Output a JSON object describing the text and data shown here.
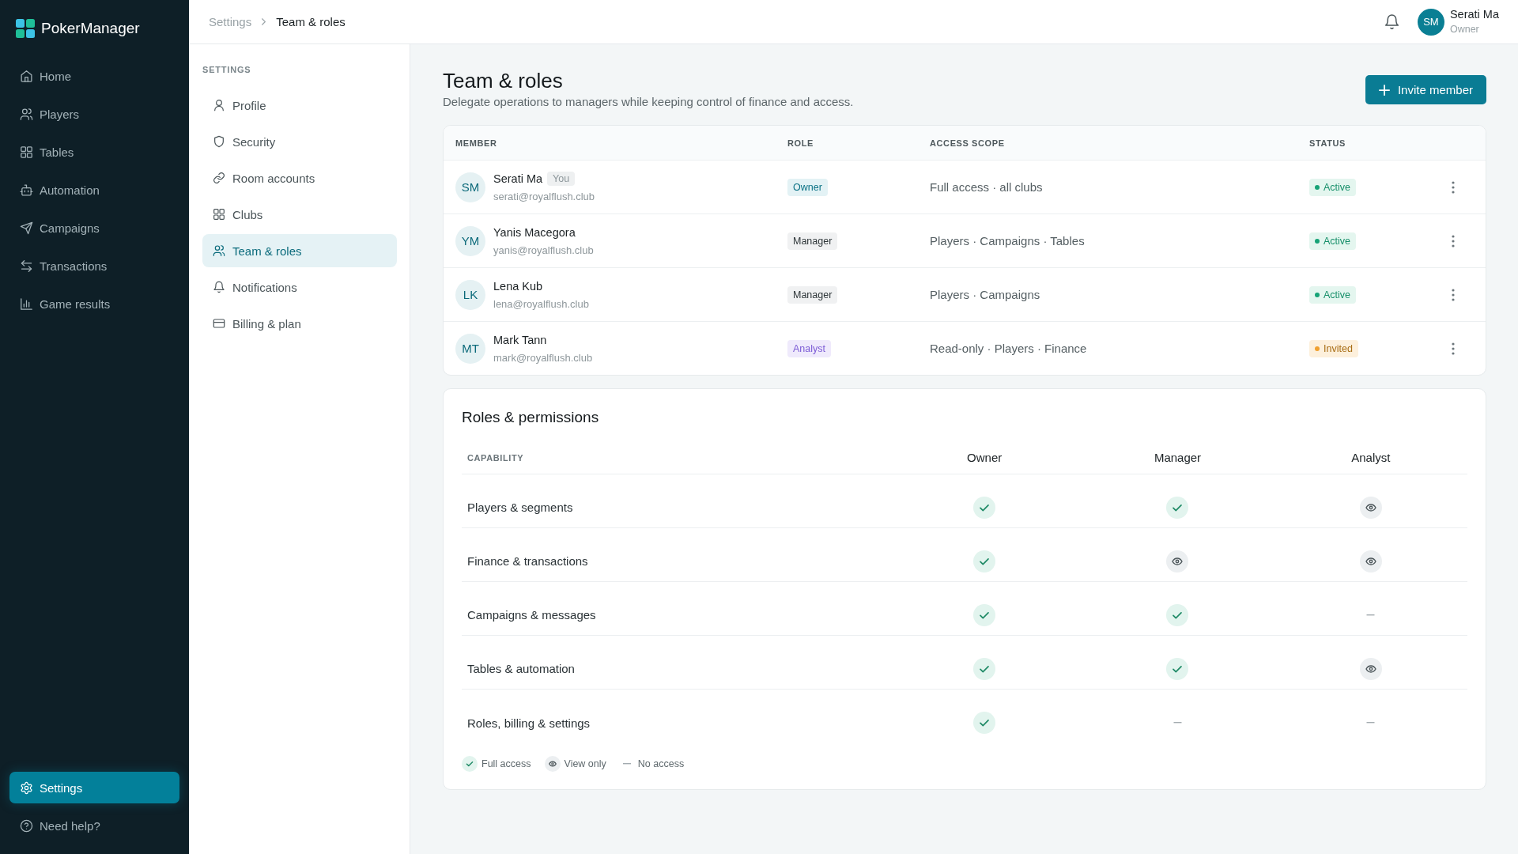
{
  "sidebar": {
    "brand": "PokerManager",
    "items": [
      {
        "label": "Home",
        "selected": false
      },
      {
        "label": "Players",
        "selected": false
      },
      {
        "label": "Tables",
        "selected": false
      },
      {
        "label": "Automation",
        "selected": false
      },
      {
        "label": "Campaigns",
        "selected": false
      },
      {
        "label": "Transactions",
        "selected": false
      },
      {
        "label": "Game results",
        "selected": false
      }
    ],
    "footer_items": [
      {
        "label": "Settings",
        "selected": true
      },
      {
        "label": "Need help?",
        "selected": false
      }
    ]
  },
  "topbar": {
    "breadcrumb": [
      "Settings",
      "Team & roles"
    ],
    "user": {
      "initials": "SM",
      "name": "Serati Ma",
      "role": "Owner"
    }
  },
  "settings_nav": {
    "heading": "SETTINGS",
    "items": [
      {
        "label": "Profile",
        "selected": false
      },
      {
        "label": "Security",
        "selected": false
      },
      {
        "label": "Room accounts",
        "selected": false
      },
      {
        "label": "Clubs",
        "selected": false
      },
      {
        "label": "Team & roles",
        "selected": true
      },
      {
        "label": "Notifications",
        "selected": false
      },
      {
        "label": "Billing & plan",
        "selected": false
      }
    ]
  },
  "page": {
    "title": "Team & roles",
    "subtitle": "Delegate operations to managers while keeping control of finance and access.",
    "primary_button": "Invite member"
  },
  "members_table": {
    "columns": [
      "MEMBER",
      "ROLE",
      "ACCESS SCOPE",
      "STATUS"
    ],
    "rows": [
      {
        "initials": "SM",
        "name": "Serati Ma",
        "tag": "You",
        "email": "serati@royalflush.club",
        "role": {
          "label": "Owner",
          "kind": "owner"
        },
        "access_scope": "Full access · all clubs",
        "status": {
          "label": "Active",
          "kind": "active"
        }
      },
      {
        "initials": "YM",
        "name": "Yanis Macegora",
        "email": "yanis@royalflush.club",
        "role": {
          "label": "Manager",
          "kind": "manager"
        },
        "access_scope": "Players · Campaigns · Tables",
        "status": {
          "label": "Active",
          "kind": "active"
        }
      },
      {
        "initials": "LK",
        "name": "Lena Kub",
        "email": "lena@royalflush.club",
        "role": {
          "label": "Manager",
          "kind": "manager"
        },
        "access_scope": "Players · Campaigns",
        "status": {
          "label": "Active",
          "kind": "active"
        }
      },
      {
        "initials": "MT",
        "name": "Mark Tann",
        "email": "mark@royalflush.club",
        "role": {
          "label": "Analyst",
          "kind": "analyst"
        },
        "access_scope": "Read-only · Players · Finance",
        "status": {
          "label": "Invited",
          "kind": "invited"
        }
      }
    ]
  },
  "permissions": {
    "title": "Roles & permissions",
    "capability_heading": "CAPABILITY",
    "roles": [
      "Owner",
      "Manager",
      "Analyst"
    ],
    "rows": [
      {
        "capability": "Players & segments",
        "access": [
          {
            "kind": "full"
          },
          {
            "kind": "full"
          },
          {
            "kind": "view"
          }
        ]
      },
      {
        "capability": "Finance & transactions",
        "access": [
          {
            "kind": "full"
          },
          {
            "kind": "view"
          },
          {
            "kind": "view"
          }
        ]
      },
      {
        "capability": "Campaigns & messages",
        "access": [
          {
            "kind": "full"
          },
          {
            "kind": "full"
          },
          {
            "kind": "none"
          }
        ]
      },
      {
        "capability": "Tables & automation",
        "access": [
          {
            "kind": "full"
          },
          {
            "kind": "full"
          },
          {
            "kind": "view"
          }
        ]
      },
      {
        "capability": "Roles, billing & settings",
        "access": [
          {
            "kind": "full"
          },
          {
            "kind": "none"
          },
          {
            "kind": "none"
          }
        ]
      }
    ],
    "legend": [
      {
        "kind": "full",
        "label": "Full access"
      },
      {
        "kind": "view",
        "label": "View only"
      },
      {
        "kind": "none",
        "label": "No access"
      }
    ]
  }
}
